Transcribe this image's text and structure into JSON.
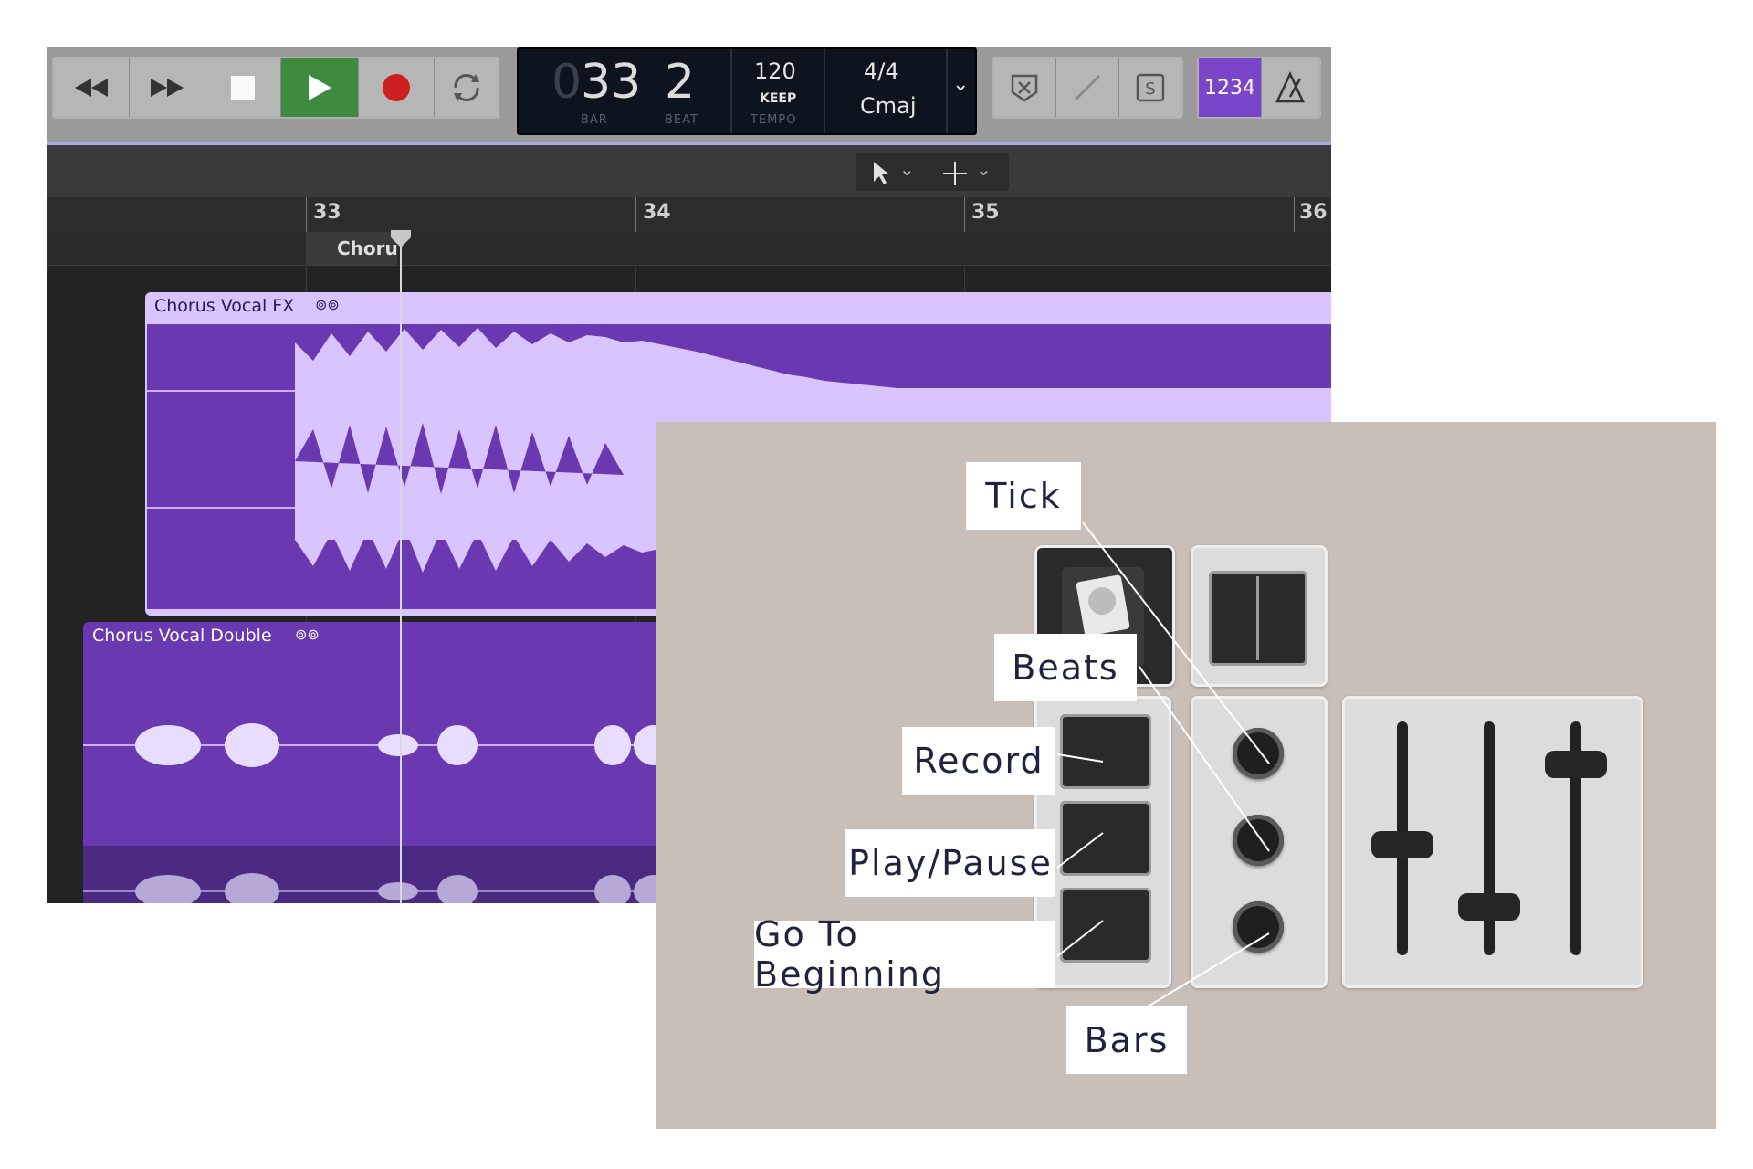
{
  "transport": {
    "buttons": [
      "rewind-icon",
      "fast-forward-icon",
      "stop-icon",
      "play-icon",
      "record-icon",
      "cycle-icon"
    ],
    "bar": "33",
    "beat": "2",
    "bar_caption": "BAR",
    "beat_caption": "BEAT",
    "tempo": "120",
    "tempo_mode": "KEEP",
    "tempo_caption": "TEMPO",
    "time_signature": "4/4",
    "key": "Cmaj",
    "count_in": "1234"
  },
  "ruler": {
    "bars": [
      "33",
      "34",
      "35",
      "36"
    ]
  },
  "marker_label": "Chorus",
  "regions": [
    {
      "name": "Chorus Vocal FX"
    },
    {
      "name": "Chorus Vocal Double"
    }
  ],
  "callouts": {
    "tick": "Tick",
    "beats": "Beats",
    "record": "Record",
    "play_pause": "Play/Pause",
    "go_to_beginning": "Go To Beginning",
    "bars": "Bars"
  },
  "colors": {
    "region_light": "#d9c4ff",
    "region_dark": "#6a38b0",
    "play_green": "#3e8a3e",
    "record_red": "#cc2020",
    "count_in_purple": "#7b45c9",
    "panel_bg": "#c8bfb8"
  }
}
